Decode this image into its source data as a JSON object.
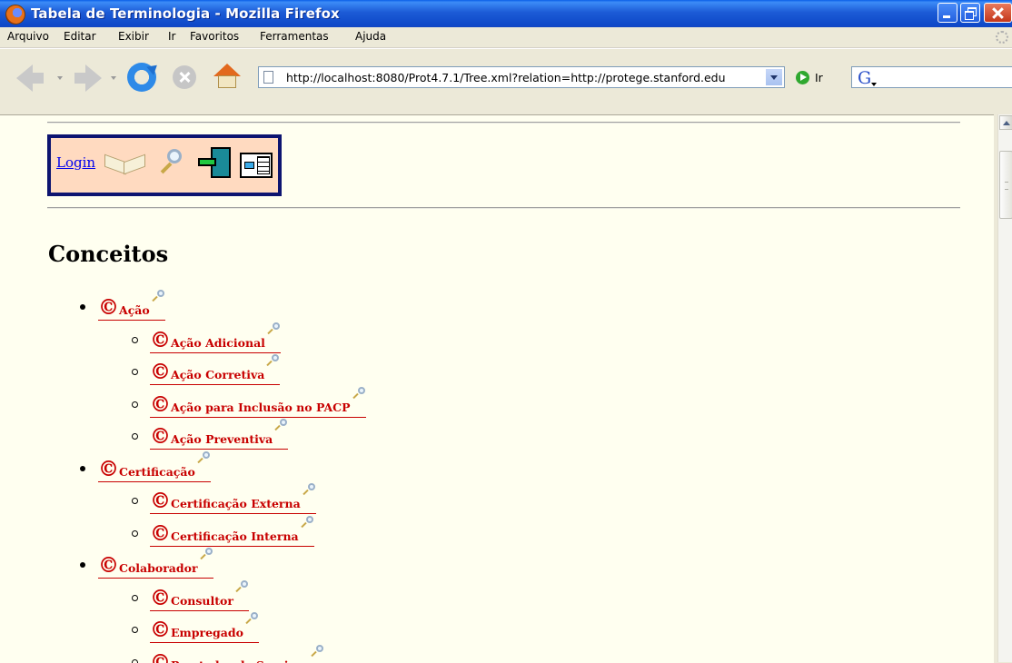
{
  "window": {
    "title": "Tabela de Terminologia - Mozilla Firefox"
  },
  "menubar": {
    "items": [
      "Arquivo",
      "Editar",
      "Exibir",
      "Ir",
      "Favoritos",
      "Ferramentas",
      "Ajuda"
    ]
  },
  "toolbar": {
    "url": "http://localhost:8080/Prot4.7.1/Tree.xml?relation=http://protege.stanford.edu",
    "go_label": "Ir",
    "search_engine_letter": "G"
  },
  "page": {
    "login_label": "Login",
    "heading": "Conceitos",
    "concept_glyph": "©",
    "tree": [
      {
        "label": "Ação",
        "level": 1
      },
      {
        "label": "Ação Adicional",
        "level": 2
      },
      {
        "label": "Ação Corretiva",
        "level": 2
      },
      {
        "label": "Ação para Inclusão no PACP",
        "level": 2
      },
      {
        "label": "Ação Preventiva",
        "level": 2
      },
      {
        "label": "Certificação",
        "level": 1
      },
      {
        "label": "Certificação Externa",
        "level": 2
      },
      {
        "label": "Certificação Interna",
        "level": 2
      },
      {
        "label": "Colaborador",
        "level": 1
      },
      {
        "label": "Consultor",
        "level": 2
      },
      {
        "label": "Empregado",
        "level": 2
      },
      {
        "label": "Prestador de Servicos",
        "level": 2
      }
    ]
  },
  "colors": {
    "concept_link": "#C80000",
    "nav_box_bg": "#FFDAC0",
    "nav_box_border": "#0D1470",
    "page_bg": "#FFFFF0"
  },
  "icons": [
    "firefox-logo-icon",
    "back-arrow-icon",
    "forward-arrow-icon",
    "reload-icon",
    "stop-icon",
    "home-icon",
    "page-icon",
    "go-icon",
    "book-icon",
    "magnifier-icon",
    "logout-door-icon",
    "tree-view-icon"
  ]
}
